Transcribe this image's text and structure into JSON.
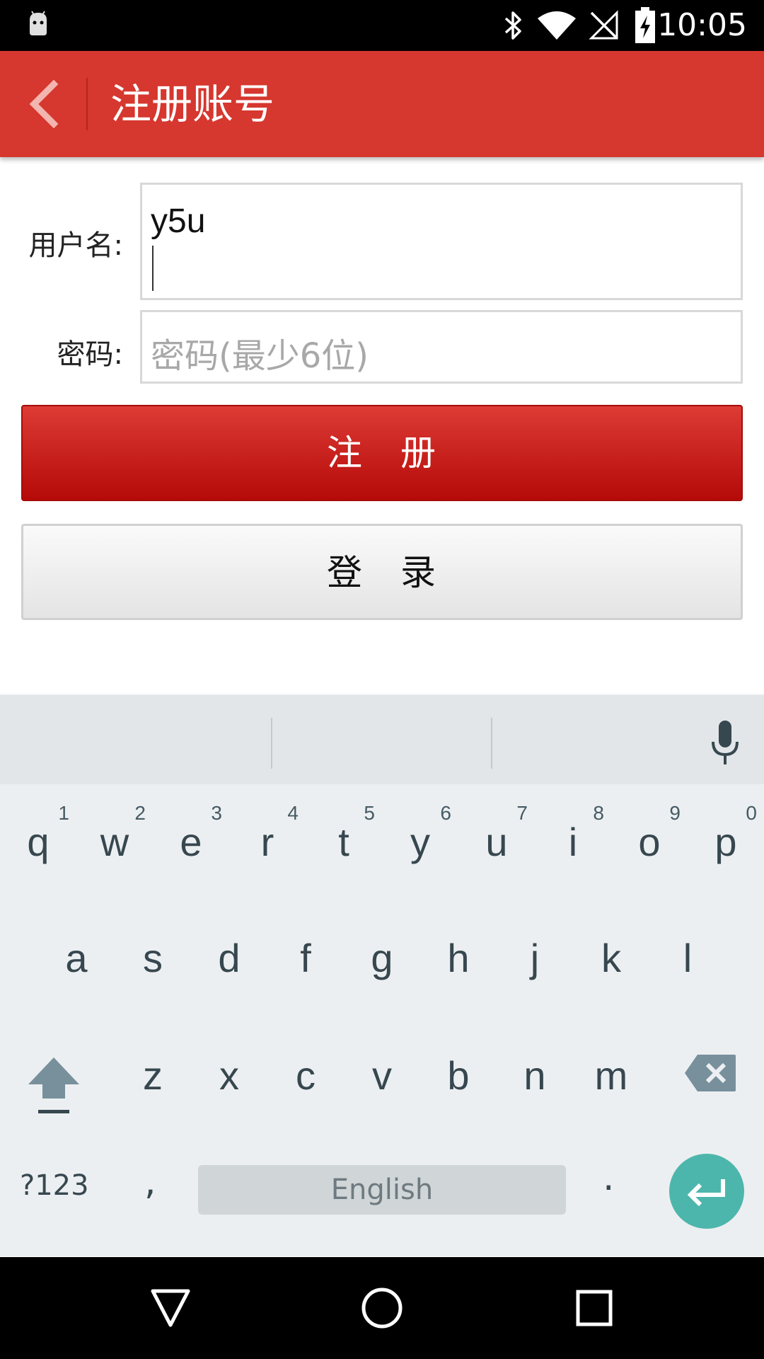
{
  "status_bar": {
    "time": "10:05",
    "icons": [
      "android-icon",
      "bluetooth-icon",
      "wifi-icon",
      "no-signal-icon",
      "battery-charging-icon"
    ]
  },
  "app_bar": {
    "title": "注册账号",
    "back_icon": "chevron-left-icon",
    "color": "#d6372e"
  },
  "form": {
    "username_label": "用户名:",
    "username_value": "y5u",
    "password_label": "密码:",
    "password_placeholder": "密码(最少6位)",
    "register_label": "注　册",
    "login_label": "登　录",
    "register_color": "#c81e1a"
  },
  "keyboard": {
    "row1": [
      {
        "letter": "q",
        "hint": "1"
      },
      {
        "letter": "w",
        "hint": "2"
      },
      {
        "letter": "e",
        "hint": "3"
      },
      {
        "letter": "r",
        "hint": "4"
      },
      {
        "letter": "t",
        "hint": "5"
      },
      {
        "letter": "y",
        "hint": "6"
      },
      {
        "letter": "u",
        "hint": "7"
      },
      {
        "letter": "i",
        "hint": "8"
      },
      {
        "letter": "o",
        "hint": "9"
      },
      {
        "letter": "p",
        "hint": "0"
      }
    ],
    "row2": [
      "a",
      "s",
      "d",
      "f",
      "g",
      "h",
      "j",
      "k",
      "l"
    ],
    "row3": [
      "z",
      "x",
      "c",
      "v",
      "b",
      "n",
      "m"
    ],
    "symbols_label": "?123",
    "comma_label": ",",
    "space_label": "English",
    "period_label": ".",
    "enter_color": "#4db6ac",
    "icons": [
      "mic-icon",
      "shift-icon",
      "backspace-icon",
      "enter-icon"
    ]
  },
  "nav_bar": {
    "icons": [
      "back-triangle-icon",
      "home-circle-icon",
      "recents-square-icon"
    ]
  }
}
